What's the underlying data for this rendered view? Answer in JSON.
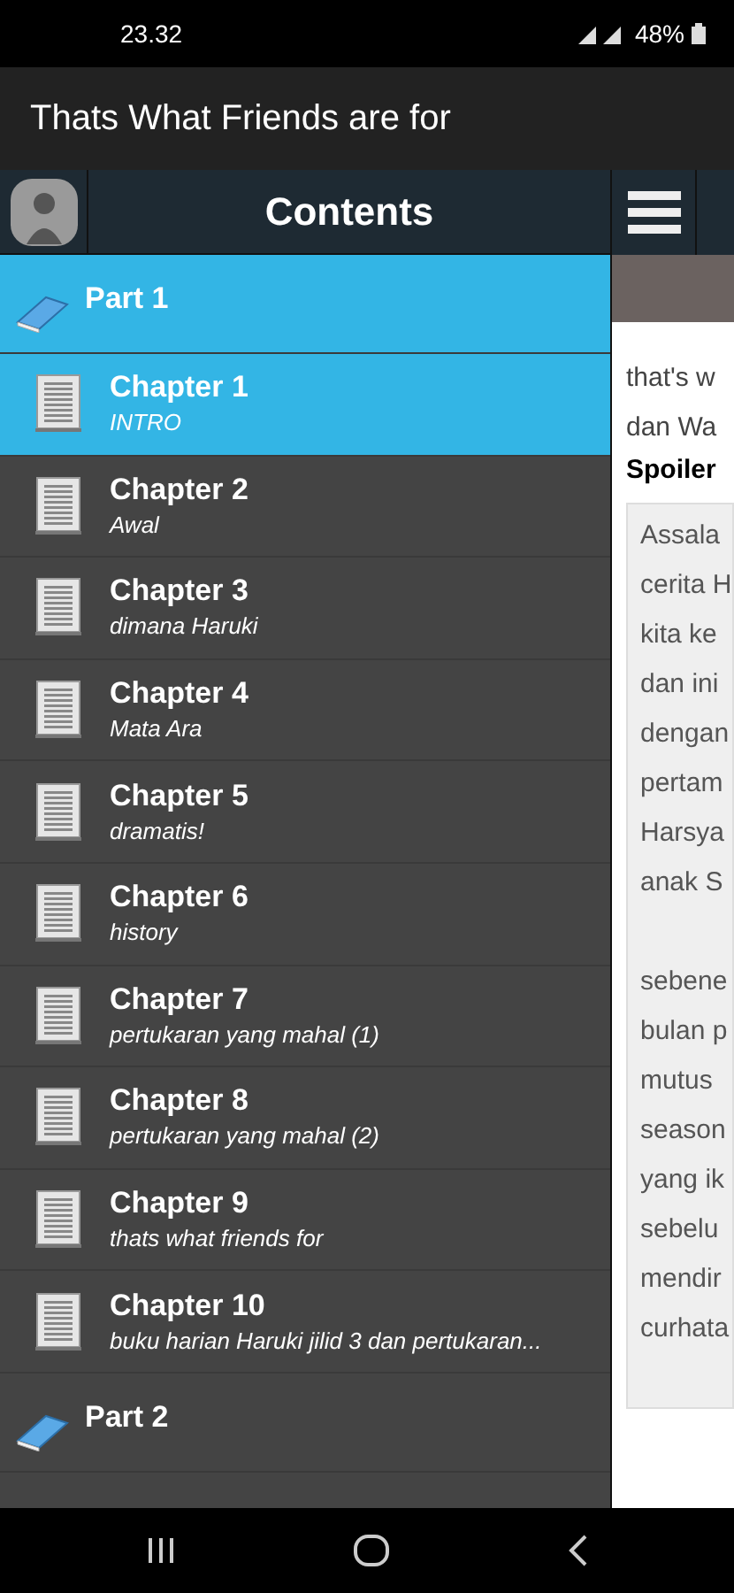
{
  "status_bar": {
    "time": "23.32",
    "battery": "48%"
  },
  "app_bar": {
    "title": "Thats What Friends are for"
  },
  "drawer": {
    "title": "Contents",
    "parts": [
      {
        "title": "Part 1",
        "selected": true,
        "chapters": [
          {
            "title": "Chapter 1",
            "subtitle": "INTRO",
            "selected": true
          },
          {
            "title": "Chapter 2",
            "subtitle": "Awal",
            "selected": false
          },
          {
            "title": "Chapter 3",
            "subtitle": "dimana Haruki",
            "selected": false
          },
          {
            "title": "Chapter 4",
            "subtitle": "Mata Ara",
            "selected": false
          },
          {
            "title": "Chapter 5",
            "subtitle": "dramatis!",
            "selected": false
          },
          {
            "title": "Chapter 6",
            "subtitle": "history",
            "selected": false
          },
          {
            "title": "Chapter 7",
            "subtitle": "pertukaran yang mahal (1)",
            "selected": false
          },
          {
            "title": "Chapter 8",
            "subtitle": "pertukaran yang mahal (2)",
            "selected": false
          },
          {
            "title": "Chapter 9",
            "subtitle": "thats what friends for",
            "selected": false
          },
          {
            "title": "Chapter 10",
            "subtitle": "buku harian Haruki jilid 3 dan pertukaran...",
            "selected": false
          }
        ]
      },
      {
        "title": "Part 2",
        "selected": false
      }
    ]
  },
  "content": {
    "intro_lines": [
      "that's w",
      "dan Wa"
    ],
    "heading": "Spoiler",
    "quote_paragraphs": [
      [
        "Assala",
        "cerita H",
        "kita ke",
        "dan ini",
        "dengan",
        "pertam",
        "Harsya",
        "anak S"
      ],
      [
        "sebene",
        "bulan p",
        "mutus",
        "season",
        "yang ik",
        "sebelu",
        "mendir",
        "curhata"
      ]
    ]
  }
}
